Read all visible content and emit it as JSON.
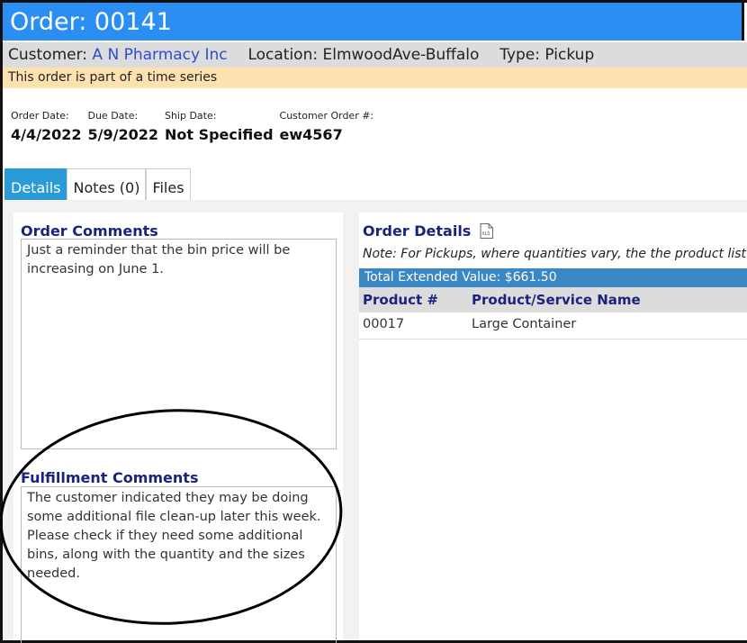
{
  "order": {
    "title": "Order: 00141",
    "customer_label": "Customer:",
    "customer_name": "A N Pharmacy Inc",
    "location_label": "Location:",
    "location_value": "ElmwoodAve-Buffalo",
    "type_label": "Type:",
    "type_value": "Pickup",
    "notice": "This order is part of a time series"
  },
  "dates": [
    {
      "label": "Order Date:",
      "value": "4/4/2022"
    },
    {
      "label": "Due Date:",
      "value": "5/9/2022"
    },
    {
      "label": "Ship Date:",
      "value": "Not Specified"
    },
    {
      "label": "Customer Order #:",
      "value": "ew4567"
    }
  ],
  "tabs": [
    {
      "label": "Details",
      "active": true
    },
    {
      "label": "Notes (0)",
      "active": false
    },
    {
      "label": "Files",
      "active": false
    }
  ],
  "order_comments": {
    "title": "Order Comments",
    "text": "Just a reminder that the bin price will be increasing on June 1."
  },
  "fulfillment_comments": {
    "title": "Fulfillment Comments",
    "text": "The customer indicated they may be doing some additional file clean-up later this week.  Please check if they need some additional bins, along with the quantity and the sizes needed."
  },
  "order_details": {
    "title": "Order Details",
    "export_icon": "xls-file-icon",
    "note": "Note: For Pickups, where quantities vary, the the product list will",
    "total": "Total Extended Value: $661.50",
    "columns": [
      "Product #",
      "Product/Service Name"
    ],
    "rows": [
      [
        "00017",
        "Large Container"
      ]
    ]
  },
  "colors": {
    "title_bar": "#2b8ef2",
    "active_tab": "#2a9bd7",
    "total_bar": "#3a87c5",
    "notice_bar": "#fde1ae",
    "heading": "#1a237e"
  }
}
